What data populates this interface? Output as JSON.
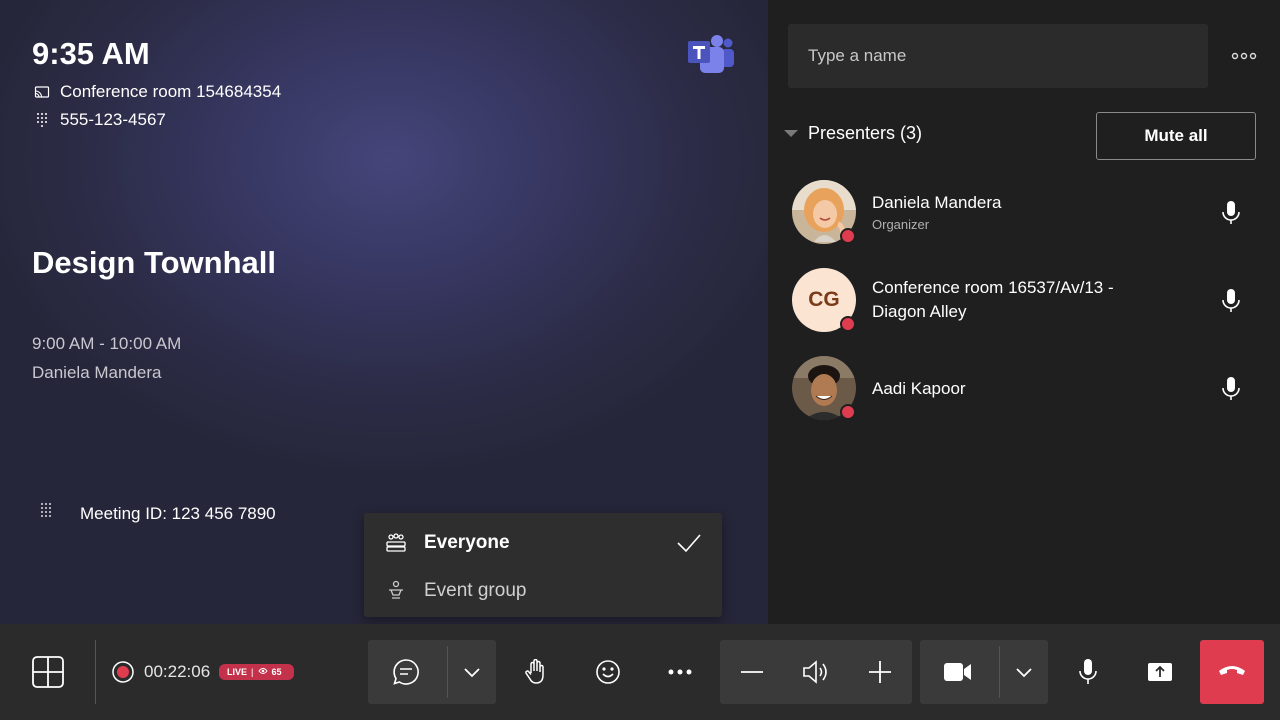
{
  "stage": {
    "time": "9:35 AM",
    "room": "Conference room 154684354",
    "phone": "555-123-4567",
    "meeting_title": "Design Townhall",
    "time_range": "9:00 AM - 10:00 AM",
    "organizer": "Daniela Mandera",
    "meeting_id": "Meeting ID: 123 456 7890"
  },
  "menu": {
    "items": [
      {
        "label": "Everyone",
        "icon": "people-group-icon",
        "selected": true
      },
      {
        "label": "Event group",
        "icon": "event-group-icon",
        "selected": false
      }
    ]
  },
  "panel": {
    "search_placeholder": "Type a name",
    "presenters_header": "Presenters (3)",
    "mute_all_label": "Mute all",
    "people": [
      {
        "name": "Daniela Mandera",
        "role": "Organizer",
        "avatar": "photo"
      },
      {
        "name_line1": "Conference room 16537/Av/13 -",
        "name_line2": "Diagon Alley",
        "initials": "CG"
      },
      {
        "name": "Aadi Kapoor",
        "avatar": "photo"
      }
    ]
  },
  "bar": {
    "timer": "00:22:06",
    "live_label": "LIVE",
    "viewer_count": "65"
  },
  "colors": {
    "accent_red": "#e03c50",
    "live_red": "#c4314b",
    "teams_purple": "#5b5fc7"
  }
}
